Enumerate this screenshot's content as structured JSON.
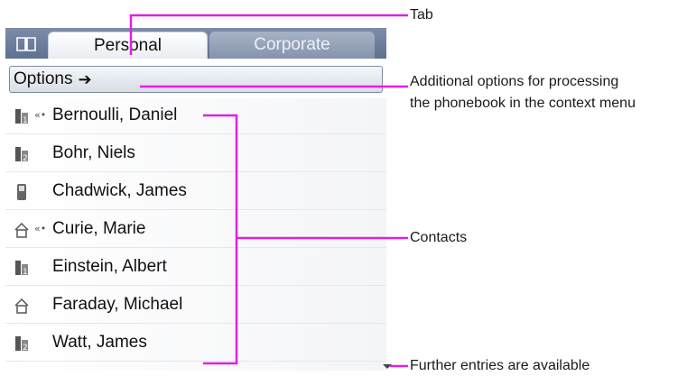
{
  "tabs": {
    "icon": "phonebook-icon",
    "personal": "Personal",
    "corporate": "Corporate"
  },
  "options": {
    "label": "Options",
    "arrow": "➔"
  },
  "contacts": [
    {
      "name": "Bernoulli, Daniel",
      "type": "office-1-icon",
      "ring": "«•"
    },
    {
      "name": "Bohr, Niels",
      "type": "office-2-icon",
      "ring": ""
    },
    {
      "name": "Chadwick, James",
      "type": "mobile-icon",
      "ring": ""
    },
    {
      "name": "Curie, Marie",
      "type": "home-icon",
      "ring": "«•"
    },
    {
      "name": "Einstein, Albert",
      "type": "office-1-icon",
      "ring": ""
    },
    {
      "name": "Faraday, Michael",
      "type": "home-icon",
      "ring": ""
    },
    {
      "name": "Watt, James",
      "type": "office-2-icon",
      "ring": ""
    }
  ],
  "annotations": {
    "tab": "Tab",
    "options_line1": "Additional options for processing",
    "options_line2": "the phonebook in the context menu",
    "contacts": "Contacts",
    "more": "Further entries are available"
  },
  "colors": {
    "callout": "#e020e0",
    "tabbar": "#6a7b98"
  }
}
